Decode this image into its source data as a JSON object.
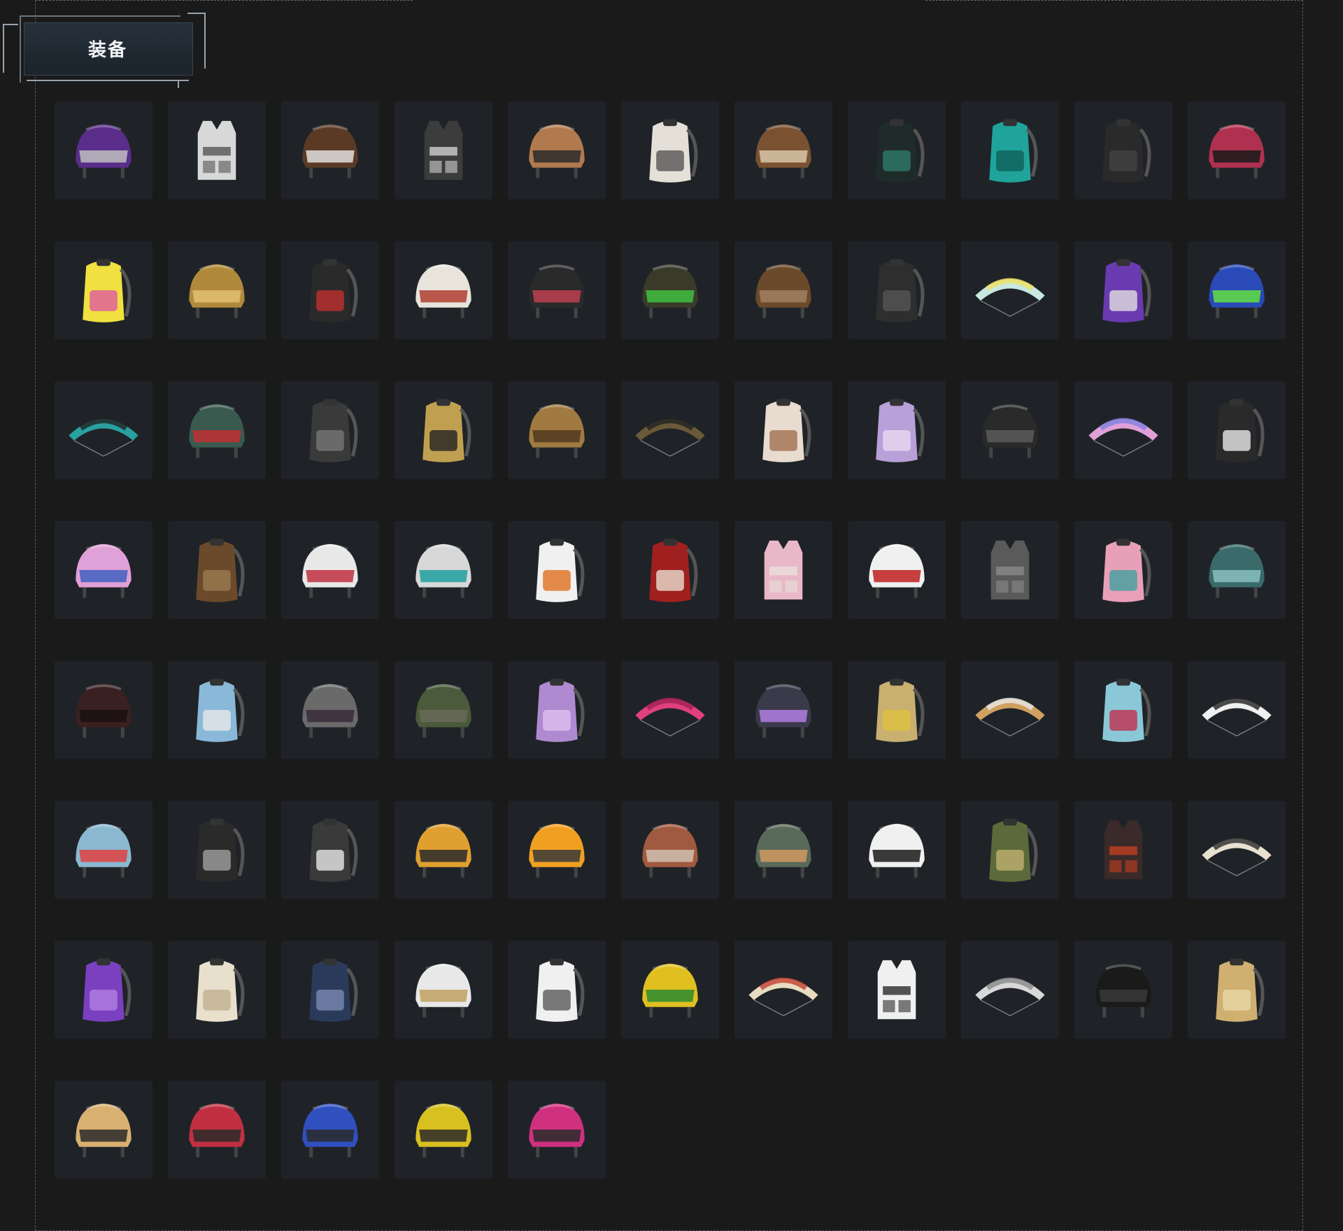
{
  "section": {
    "title": "装备"
  },
  "colors": {
    "background": "#1a1a1b",
    "tile": "#1f2328",
    "frame": "#5a5a5a"
  },
  "items": [
    {
      "icon": "helmet-icon",
      "c1": "#5a2d8a",
      "c2": "#c0c0c0"
    },
    {
      "icon": "vest-icon",
      "c1": "#d8d8d8",
      "c2": "#555"
    },
    {
      "icon": "helmet-icon",
      "c1": "#5b3a25",
      "c2": "#e0e0e0"
    },
    {
      "icon": "vest-icon",
      "c1": "#3c3c3c",
      "c2": "#d0d0d0"
    },
    {
      "icon": "helmet-icon",
      "c1": "#b07a4e",
      "c2": "#2a2a2a"
    },
    {
      "icon": "backpack-icon",
      "c1": "#e4e0d8",
      "c2": "#555"
    },
    {
      "icon": "helmet-icon",
      "c1": "#7a5232",
      "c2": "#d8c7a8"
    },
    {
      "icon": "backpack-icon",
      "c1": "#1f2b28",
      "c2": "#2f7a6a"
    },
    {
      "icon": "backpack-icon",
      "c1": "#1fa39a",
      "c2": "#0e5f58"
    },
    {
      "icon": "backpack-icon",
      "c1": "#2a2a2a",
      "c2": "#444"
    },
    {
      "icon": "helmet-icon",
      "c1": "#b0314f",
      "c2": "#1a1a1a"
    },
    {
      "icon": "backpack-icon",
      "c1": "#f0e040",
      "c2": "#e05aa0"
    },
    {
      "icon": "helmet-icon",
      "c1": "#b08a3a",
      "c2": "#e0c070"
    },
    {
      "icon": "backpack-icon",
      "c1": "#2a2a2a",
      "c2": "#c03030"
    },
    {
      "icon": "helmet-icon",
      "c1": "#e8e4dc",
      "c2": "#b04030"
    },
    {
      "icon": "helmet-icon",
      "c1": "#2a2a2a",
      "c2": "#c04050"
    },
    {
      "icon": "helmet-icon",
      "c1": "#3a3a2a",
      "c2": "#40c040"
    },
    {
      "icon": "helmet-icon",
      "c1": "#6a4a2a",
      "c2": "#a08060"
    },
    {
      "icon": "backpack-icon",
      "c1": "#2e2e2e",
      "c2": "#555"
    },
    {
      "icon": "parachute-icon",
      "c1": "#c8e8e0",
      "c2": "#f0e060"
    },
    {
      "icon": "backpack-icon",
      "c1": "#6a3ab0",
      "c2": "#e0e0e0"
    },
    {
      "icon": "helmet-icon",
      "c1": "#2a4ab8",
      "c2": "#60e040"
    },
    {
      "icon": "parachute-icon",
      "c1": "#2aa0a0",
      "c2": "#202020"
    },
    {
      "icon": "helmet-icon",
      "c1": "#3a5a50",
      "c2": "#c03030"
    },
    {
      "icon": "backpack-icon",
      "c1": "#3a3a3a",
      "c2": "#777"
    },
    {
      "icon": "backpack-icon",
      "c1": "#c0a050",
      "c2": "#222"
    },
    {
      "icon": "helmet-icon",
      "c1": "#a07a40",
      "c2": "#503a20"
    },
    {
      "icon": "parachute-icon",
      "c1": "#6a5a3a",
      "c2": "#222"
    },
    {
      "icon": "backpack-icon",
      "c1": "#e8dcd0",
      "c2": "#a07050"
    },
    {
      "icon": "backpack-icon",
      "c1": "#b8a0d8",
      "c2": "#e8d8f0"
    },
    {
      "icon": "helmet-icon",
      "c1": "#2a2a2a",
      "c2": "#5a5a5a"
    },
    {
      "icon": "parachute-icon",
      "c1": "#e0a0d8",
      "c2": "#8080e0"
    },
    {
      "icon": "backpack-icon",
      "c1": "#2a2a2a",
      "c2": "#e8e8e8"
    },
    {
      "icon": "helmet-icon",
      "c1": "#e0a0d8",
      "c2": "#4060c0"
    },
    {
      "icon": "backpack-icon",
      "c1": "#6a4a2a",
      "c2": "#9a7a50"
    },
    {
      "icon": "helmet-icon",
      "c1": "#e8e8e8",
      "c2": "#c03040"
    },
    {
      "icon": "helmet-icon",
      "c1": "#d8d8d8",
      "c2": "#20a0a0"
    },
    {
      "icon": "backpack-icon",
      "c1": "#f0f0f0",
      "c2": "#e07020"
    },
    {
      "icon": "backpack-icon",
      "c1": "#a02020",
      "c2": "#e8e0d0"
    },
    {
      "icon": "vest-icon",
      "c1": "#e8b8c8",
      "c2": "#e8e0d8"
    },
    {
      "icon": "helmet-icon",
      "c1": "#f0f0f0",
      "c2": "#c02020"
    },
    {
      "icon": "vest-icon",
      "c1": "#5a5a5a",
      "c2": "#8a8a8a"
    },
    {
      "icon": "backpack-icon",
      "c1": "#e8a0b8",
      "c2": "#40a0a0"
    },
    {
      "icon": "helmet-icon",
      "c1": "#3a6a6a",
      "c2": "#8ac0c0"
    },
    {
      "icon": "helmet-icon",
      "c1": "#3a2020",
      "c2": "#1a1010"
    },
    {
      "icon": "backpack-icon",
      "c1": "#8ab8d8",
      "c2": "#e8e8e8"
    },
    {
      "icon": "helmet-icon",
      "c1": "#6a6a6a",
      "c2": "#3a2a3a"
    },
    {
      "icon": "helmet-icon",
      "c1": "#4a5a3a",
      "c2": "#6a6a5a"
    },
    {
      "icon": "backpack-icon",
      "c1": "#b08ad0",
      "c2": "#e0c0f0"
    },
    {
      "icon": "parachute-icon",
      "c1": "#e04080",
      "c2": "#a02050"
    },
    {
      "icon": "helmet-icon",
      "c1": "#3a3a4a",
      "c2": "#b080e0"
    },
    {
      "icon": "backpack-icon",
      "c1": "#c8b070",
      "c2": "#e0c040"
    },
    {
      "icon": "parachute-icon",
      "c1": "#d0a060",
      "c2": "#e8e8e8"
    },
    {
      "icon": "backpack-icon",
      "c1": "#8ac8d8",
      "c2": "#c03050"
    },
    {
      "icon": "parachute-icon",
      "c1": "#f0f0f0",
      "c2": "#202020"
    },
    {
      "icon": "helmet-icon",
      "c1": "#8ab8d0",
      "c2": "#e04040"
    },
    {
      "icon": "backpack-icon",
      "c1": "#2a2a2a",
      "c2": "#a0a0a0"
    },
    {
      "icon": "backpack-icon",
      "c1": "#3a3a3a",
      "c2": "#e8e8e8"
    },
    {
      "icon": "helmet-icon",
      "c1": "#e0a030",
      "c2": "#2a2a2a"
    },
    {
      "icon": "helmet-icon",
      "c1": "#f0a020",
      "c2": "#3a3a3a"
    },
    {
      "icon": "helmet-icon",
      "c1": "#a05a40",
      "c2": "#d0c0b0"
    },
    {
      "icon": "helmet-icon",
      "c1": "#5a6a5a",
      "c2": "#d09a60"
    },
    {
      "icon": "helmet-icon",
      "c1": "#f0f0f0",
      "c2": "#1a1a1a"
    },
    {
      "icon": "backpack-icon",
      "c1": "#5a6a3a",
      "c2": "#c0b070"
    },
    {
      "icon": "vest-icon",
      "c1": "#3a2a2a",
      "c2": "#c04020"
    },
    {
      "icon": "parachute-icon",
      "c1": "#e8e0d0",
      "c2": "#2a2a2a"
    },
    {
      "icon": "backpack-icon",
      "c1": "#7a40c0",
      "c2": "#b080e0"
    },
    {
      "icon": "backpack-icon",
      "c1": "#e8e0cc",
      "c2": "#c0b090"
    },
    {
      "icon": "backpack-icon",
      "c1": "#2a3a5a",
      "c2": "#7a8ab0"
    },
    {
      "icon": "helmet-icon",
      "c1": "#e8e8e8",
      "c2": "#c0a060"
    },
    {
      "icon": "backpack-icon",
      "c1": "#f0f0f0",
      "c2": "#5a5a5a"
    },
    {
      "icon": "helmet-icon",
      "c1": "#e0c020",
      "c2": "#2a8a30"
    },
    {
      "icon": "parachute-icon",
      "c1": "#e8dcc0",
      "c2": "#c04030"
    },
    {
      "icon": "vest-icon",
      "c1": "#f0f0f0",
      "c2": "#2a2a2a"
    },
    {
      "icon": "parachute-icon",
      "c1": "#d8d8d8",
      "c2": "#8a8a8a"
    },
    {
      "icon": "helmet-icon",
      "c1": "#1a1a1a",
      "c2": "#3a3a3a"
    },
    {
      "icon": "backpack-icon",
      "c1": "#d0b070",
      "c2": "#e8d8a8"
    },
    {
      "icon": "helmet-icon",
      "c1": "#d8b070",
      "c2": "#2a2a2a"
    },
    {
      "icon": "helmet-icon",
      "c1": "#c03040",
      "c2": "#2a2a2a"
    },
    {
      "icon": "helmet-icon",
      "c1": "#3050c0",
      "c2": "#2a2a2a"
    },
    {
      "icon": "helmet-icon",
      "c1": "#d8c020",
      "c2": "#2a2a2a"
    },
    {
      "icon": "helmet-icon",
      "c1": "#d03080",
      "c2": "#2a2a2a"
    }
  ]
}
